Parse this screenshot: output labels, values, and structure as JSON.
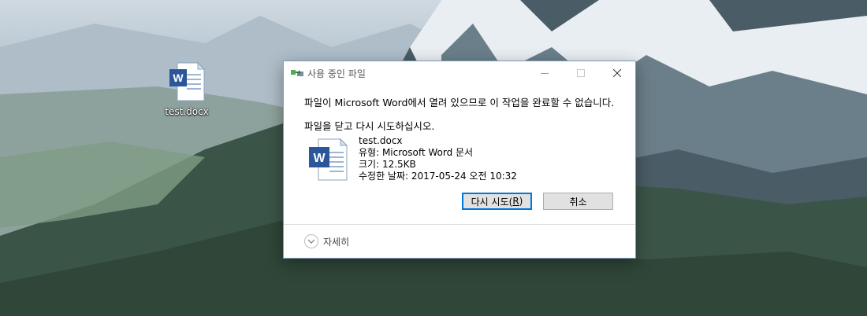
{
  "desktop": {
    "icon_label": "test.docx"
  },
  "dialog": {
    "title": "사용 중인 파일",
    "message_line1": "파일이 Microsoft Word에서 열려 있으므로 이 작업을 완료할 수 없습니다.",
    "message_line2": "파일을 닫고 다시 시도하십시오.",
    "file": {
      "name": "test.docx",
      "type": "유형: Microsoft Word 문서",
      "size": "크기: 12.5KB",
      "modified": "수정한 날짜: 2017-05-24 오전 10:32"
    },
    "retry_label": "다시 시도(R)",
    "retry_mnemonic_pre": "다시 시도(",
    "retry_mnemonic_key": "R",
    "retry_mnemonic_post": ")",
    "cancel_label": "취소",
    "details_label": "자세히"
  },
  "colors": {
    "accent": "#0078d7",
    "word_blue": "#2b579a"
  },
  "icons": {
    "title": "file-in-use-icon",
    "file": "word-document-icon",
    "desktop": "word-document-icon",
    "details": "chevron-down-icon"
  }
}
